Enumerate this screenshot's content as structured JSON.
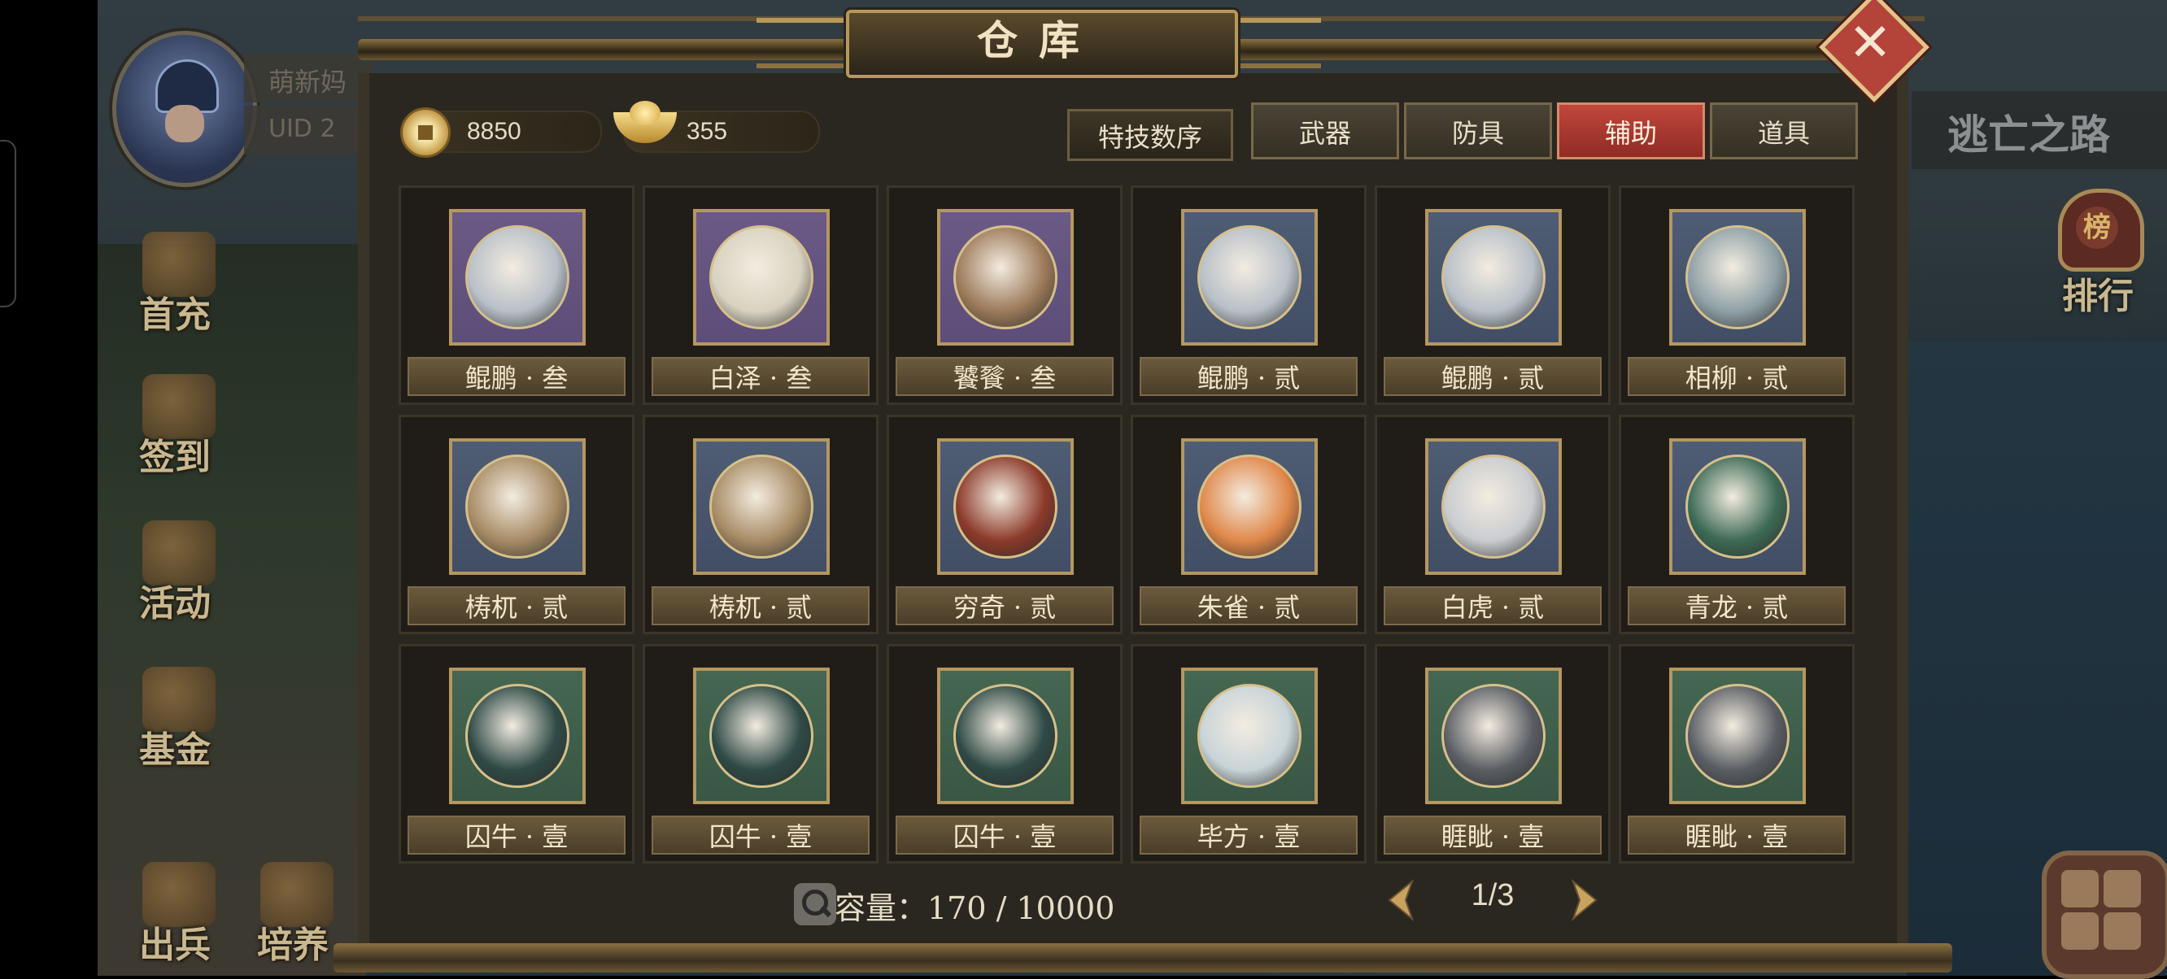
{
  "window_title": "仓库",
  "player": {
    "name": "萌新妈",
    "uid_label": "UID 2"
  },
  "left_menu": [
    {
      "label": "首充"
    },
    {
      "label": "签到"
    },
    {
      "label": "活动"
    },
    {
      "label": "基金"
    },
    {
      "label": "出兵"
    },
    {
      "label": "培养"
    }
  ],
  "right_hud": {
    "route_label": "逃亡之路",
    "rank_label": "排行",
    "rank_icon_char": "榜"
  },
  "currency": {
    "coins": "8850",
    "ingots": "355"
  },
  "toolbar": {
    "sort_label": "特技数序"
  },
  "tabs": [
    {
      "label": "武器",
      "active": false
    },
    {
      "label": "防具",
      "active": false
    },
    {
      "label": "辅助",
      "active": true
    },
    {
      "label": "道具",
      "active": false
    }
  ],
  "items": [
    {
      "name": "鲲鹏 · 叁",
      "bg": "purple",
      "icon": "kunpeng-whale-icon",
      "tint": "#b8c0c8"
    },
    {
      "name": "白泽 · 叁",
      "bg": "purple",
      "icon": "baize-beast-icon",
      "tint": "#d8d2c0"
    },
    {
      "name": "饕餮 · 叁",
      "bg": "purple",
      "icon": "taotie-beast-icon",
      "tint": "#9c7a5a"
    },
    {
      "name": "鲲鹏 · 贰",
      "bg": "blue",
      "icon": "kunpeng-whale-icon",
      "tint": "#b8c0c8"
    },
    {
      "name": "鲲鹏 · 贰",
      "bg": "blue",
      "icon": "kunpeng-whale-icon",
      "tint": "#b8c0c8"
    },
    {
      "name": "相柳 · 贰",
      "bg": "blue",
      "icon": "xiangliu-serpent-icon",
      "tint": "#8ea0a6"
    },
    {
      "name": "梼杌 · 贰",
      "bg": "blue",
      "icon": "taowu-beast-icon",
      "tint": "#a88c66"
    },
    {
      "name": "梼杌 · 贰",
      "bg": "blue",
      "icon": "taowu-beast-icon",
      "tint": "#a88c66"
    },
    {
      "name": "穷奇 · 贰",
      "bg": "blue",
      "icon": "qiongqi-beast-icon",
      "tint": "#8c3a2a"
    },
    {
      "name": "朱雀 · 贰",
      "bg": "blue",
      "icon": "zhuque-phoenix-icon",
      "tint": "#e0884a"
    },
    {
      "name": "白虎 · 贰",
      "bg": "blue",
      "icon": "baihu-tiger-icon",
      "tint": "#c9ccd0"
    },
    {
      "name": "青龙 · 贰",
      "bg": "blue",
      "icon": "qinglong-dragon-icon",
      "tint": "#3d6a55"
    },
    {
      "name": "囚牛 · 壹",
      "bg": "green",
      "icon": "qiuniu-dragon-icon",
      "tint": "#2f4a46"
    },
    {
      "name": "囚牛 · 壹",
      "bg": "green",
      "icon": "qiuniu-dragon-icon",
      "tint": "#2f4a46"
    },
    {
      "name": "囚牛 · 壹",
      "bg": "green",
      "icon": "qiuniu-dragon-icon",
      "tint": "#2f4a46"
    },
    {
      "name": "毕方 · 壹",
      "bg": "green",
      "icon": "bifang-crane-icon",
      "tint": "#c8d4d8"
    },
    {
      "name": "睚眦 · 壹",
      "bg": "green",
      "icon": "yazi-beast-icon",
      "tint": "#5a5e64"
    },
    {
      "name": "睚眦 · 壹",
      "bg": "green",
      "icon": "yazi-beast-icon",
      "tint": "#5a5e64"
    }
  ],
  "capacity": {
    "text": "容量：170 / 10000"
  },
  "pagination": {
    "text": "1/3"
  },
  "colors": {
    "active_tab": "#b03a32",
    "panel": "#2a2720",
    "gold_trim": "#b59760"
  }
}
